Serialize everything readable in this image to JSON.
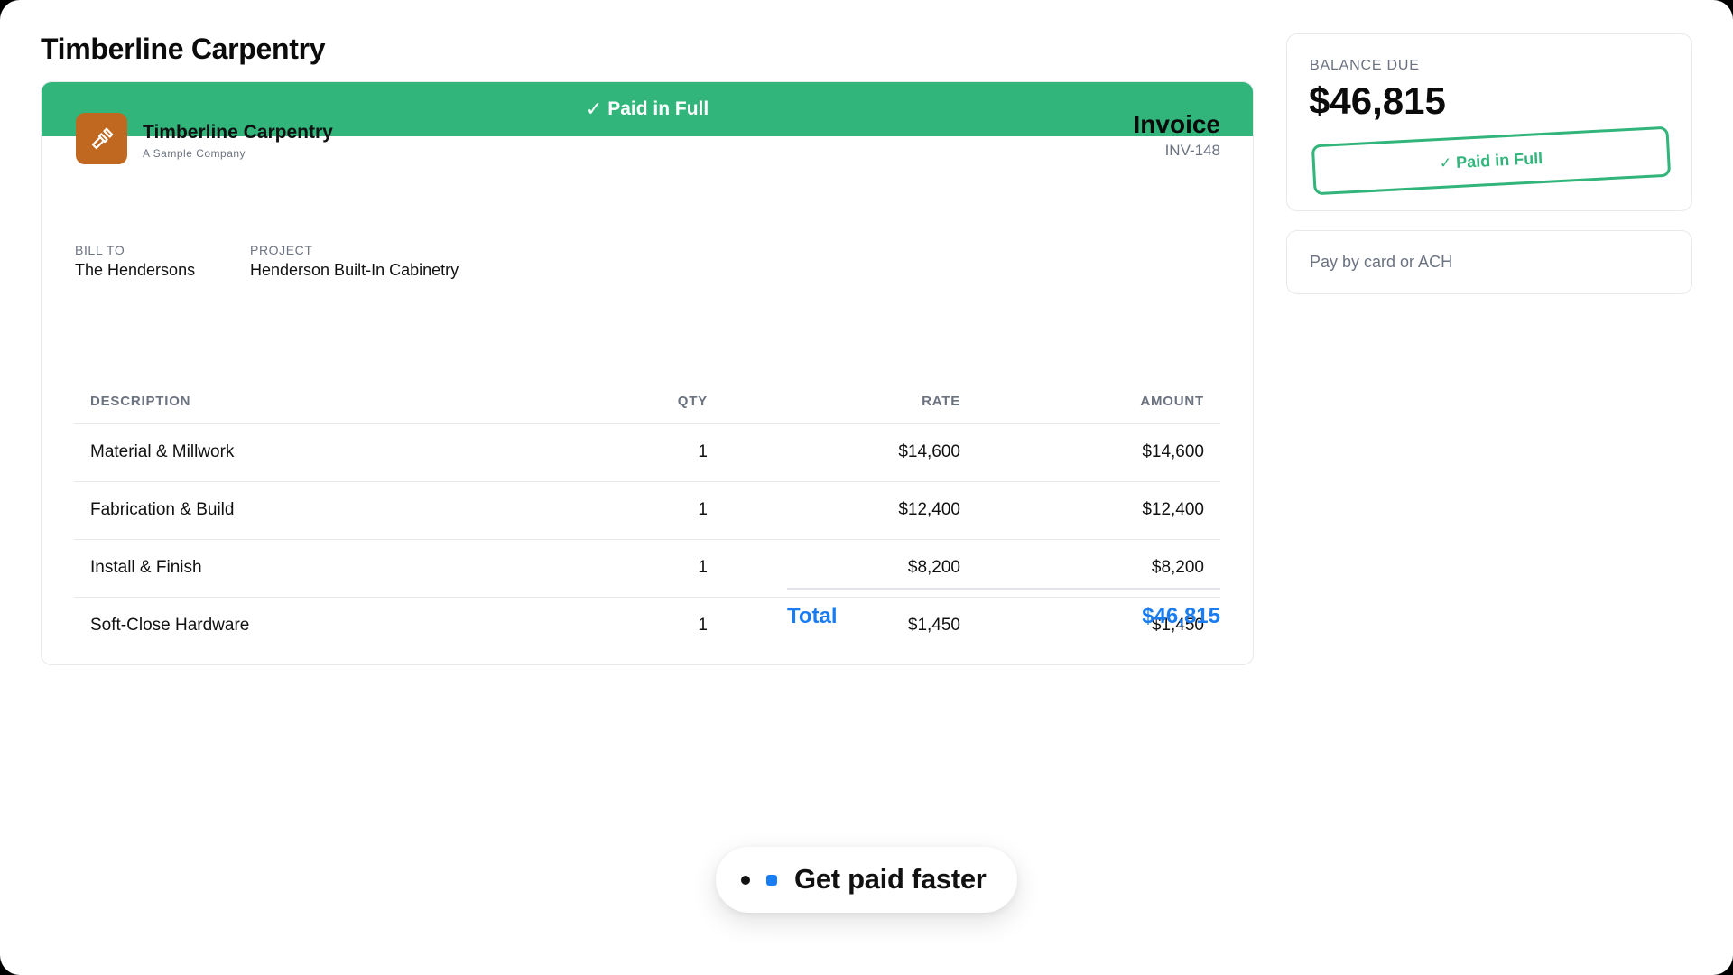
{
  "page": {
    "title": "Timberline Carpentry"
  },
  "invoice": {
    "banner": {
      "check": "✓",
      "text": "Paid in Full"
    },
    "company": {
      "name": "Timberline Carpentry",
      "tagline": "A Sample Company",
      "logo_icon": "hammer-icon",
      "logo_color": "#c0681f"
    },
    "label": "Invoice",
    "number": "INV-148",
    "bill_to": {
      "label": "BILL TO",
      "value": "The Hendersons"
    },
    "project": {
      "label": "PROJECT",
      "value": "Henderson Built-In Cabinetry"
    },
    "columns": {
      "description": "DESCRIPTION",
      "qty": "QTY",
      "rate": "RATE",
      "amount": "AMOUNT"
    },
    "items": [
      {
        "description": "Material & Millwork",
        "qty": "1",
        "rate": "$14,600",
        "amount": "$14,600"
      },
      {
        "description": "Fabrication & Build",
        "qty": "1",
        "rate": "$12,400",
        "amount": "$12,400"
      },
      {
        "description": "Install & Finish",
        "qty": "1",
        "rate": "$8,200",
        "amount": "$8,200"
      },
      {
        "description": "Soft-Close Hardware",
        "qty": "1",
        "rate": "$1,450",
        "amount": "$1,450"
      }
    ],
    "total": {
      "label": "Total",
      "value": "$46,815"
    }
  },
  "balance": {
    "label": "BALANCE DUE",
    "amount": "$46,815",
    "stamp": {
      "check": "✓",
      "text": "Paid in Full"
    }
  },
  "payment": {
    "text": "Pay by card or ACH"
  },
  "promo": {
    "text": "Get paid faster"
  },
  "colors": {
    "paid_green": "#31b57b",
    "accent_blue": "#1a7cf2"
  }
}
